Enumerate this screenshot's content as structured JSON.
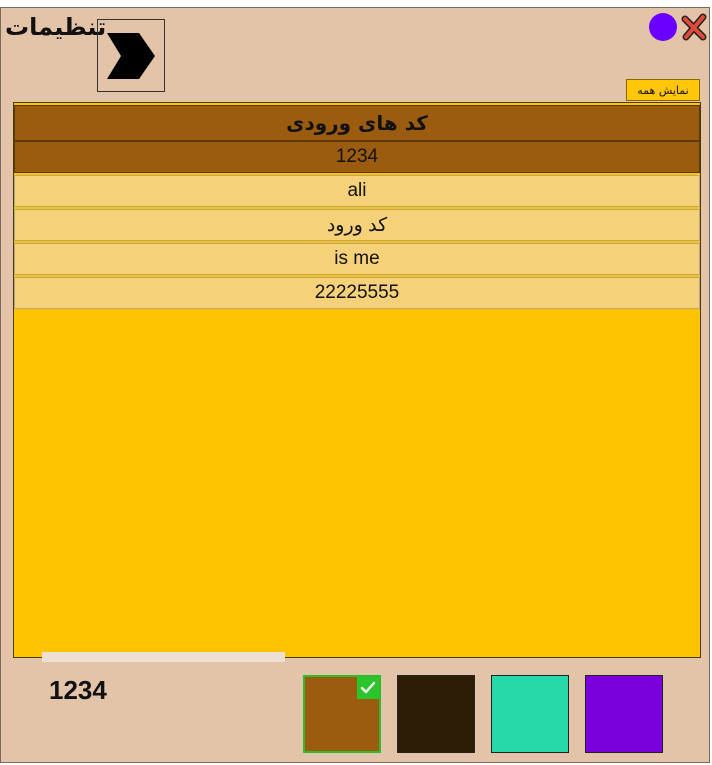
{
  "window": {
    "title": "تنظیمات",
    "show_all_label": "نمایش همه"
  },
  "codes_list": {
    "header": "کد های ورودی",
    "items": [
      "1234",
      "ali",
      "کد ورود",
      "is me",
      "22225555"
    ],
    "selected_index": 0
  },
  "current_code": "1234",
  "color_swatches": [
    {
      "name": "brown",
      "color": "#9c5c10",
      "selected": true
    },
    {
      "name": "dark-brown",
      "color": "#2e1d06",
      "selected": false
    },
    {
      "name": "teal",
      "color": "#27d9a8",
      "selected": false
    },
    {
      "name": "purple",
      "color": "#7a00dc",
      "selected": false
    }
  ],
  "colors": {
    "background": "#e3c4a9",
    "panel": "#ffc400",
    "row": "#f5d27a",
    "row_selected": "#9c5c10",
    "accent_dot": "#6a00ff",
    "close": "#d62020"
  },
  "icons": {
    "next": "chevron-right-icon",
    "close": "close-icon",
    "status": "circle-icon",
    "check": "check-icon"
  }
}
